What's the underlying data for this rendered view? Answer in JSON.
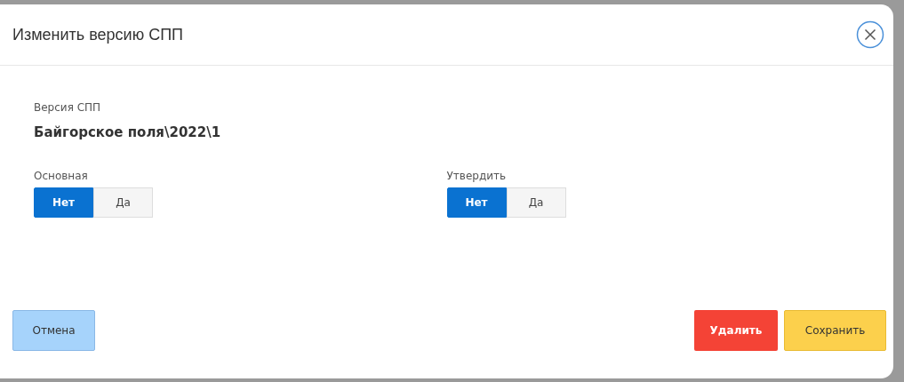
{
  "dialog": {
    "title": "Изменить версию СПП"
  },
  "version": {
    "label": "Версия СПП",
    "value": "Байгорское поля\\2022\\1"
  },
  "toggles": [
    {
      "label": "Основная",
      "options": [
        {
          "label": "Нет",
          "selected": true
        },
        {
          "label": "Да",
          "selected": false
        }
      ]
    },
    {
      "label": "Утвердить",
      "options": [
        {
          "label": "Нет",
          "selected": true
        },
        {
          "label": "Да",
          "selected": false
        }
      ]
    }
  ],
  "buttons": [
    {
      "label": "Отмена",
      "kind": "cancel"
    },
    {
      "label": "Удалить",
      "kind": "danger"
    },
    {
      "label": "Сохранить",
      "kind": "warning"
    }
  ]
}
